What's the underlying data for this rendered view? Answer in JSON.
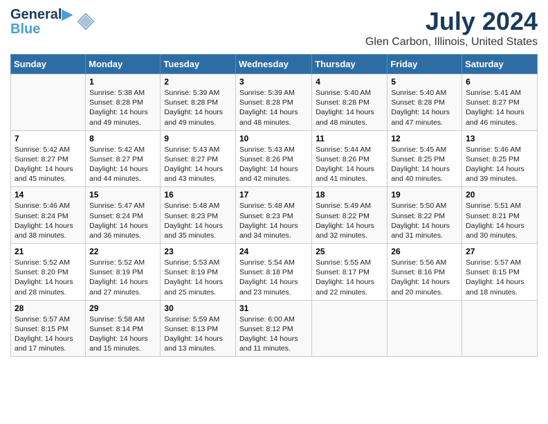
{
  "header": {
    "logo_line1": "General",
    "logo_line2": "Blue",
    "title": "July 2024",
    "subtitle": "Glen Carbon, Illinois, United States"
  },
  "days_of_week": [
    "Sunday",
    "Monday",
    "Tuesday",
    "Wednesday",
    "Thursday",
    "Friday",
    "Saturday"
  ],
  "weeks": [
    [
      {
        "day": "",
        "info": ""
      },
      {
        "day": "1",
        "info": "Sunrise: 5:38 AM\nSunset: 8:28 PM\nDaylight: 14 hours\nand 49 minutes."
      },
      {
        "day": "2",
        "info": "Sunrise: 5:39 AM\nSunset: 8:28 PM\nDaylight: 14 hours\nand 49 minutes."
      },
      {
        "day": "3",
        "info": "Sunrise: 5:39 AM\nSunset: 8:28 PM\nDaylight: 14 hours\nand 48 minutes."
      },
      {
        "day": "4",
        "info": "Sunrise: 5:40 AM\nSunset: 8:28 PM\nDaylight: 14 hours\nand 48 minutes."
      },
      {
        "day": "5",
        "info": "Sunrise: 5:40 AM\nSunset: 8:28 PM\nDaylight: 14 hours\nand 47 minutes."
      },
      {
        "day": "6",
        "info": "Sunrise: 5:41 AM\nSunset: 8:27 PM\nDaylight: 14 hours\nand 46 minutes."
      }
    ],
    [
      {
        "day": "7",
        "info": "Sunrise: 5:42 AM\nSunset: 8:27 PM\nDaylight: 14 hours\nand 45 minutes."
      },
      {
        "day": "8",
        "info": "Sunrise: 5:42 AM\nSunset: 8:27 PM\nDaylight: 14 hours\nand 44 minutes."
      },
      {
        "day": "9",
        "info": "Sunrise: 5:43 AM\nSunset: 8:27 PM\nDaylight: 14 hours\nand 43 minutes."
      },
      {
        "day": "10",
        "info": "Sunrise: 5:43 AM\nSunset: 8:26 PM\nDaylight: 14 hours\nand 42 minutes."
      },
      {
        "day": "11",
        "info": "Sunrise: 5:44 AM\nSunset: 8:26 PM\nDaylight: 14 hours\nand 41 minutes."
      },
      {
        "day": "12",
        "info": "Sunrise: 5:45 AM\nSunset: 8:25 PM\nDaylight: 14 hours\nand 40 minutes."
      },
      {
        "day": "13",
        "info": "Sunrise: 5:46 AM\nSunset: 8:25 PM\nDaylight: 14 hours\nand 39 minutes."
      }
    ],
    [
      {
        "day": "14",
        "info": "Sunrise: 5:46 AM\nSunset: 8:24 PM\nDaylight: 14 hours\nand 38 minutes."
      },
      {
        "day": "15",
        "info": "Sunrise: 5:47 AM\nSunset: 8:24 PM\nDaylight: 14 hours\nand 36 minutes."
      },
      {
        "day": "16",
        "info": "Sunrise: 5:48 AM\nSunset: 8:23 PM\nDaylight: 14 hours\nand 35 minutes."
      },
      {
        "day": "17",
        "info": "Sunrise: 5:48 AM\nSunset: 8:23 PM\nDaylight: 14 hours\nand 34 minutes."
      },
      {
        "day": "18",
        "info": "Sunrise: 5:49 AM\nSunset: 8:22 PM\nDaylight: 14 hours\nand 32 minutes."
      },
      {
        "day": "19",
        "info": "Sunrise: 5:50 AM\nSunset: 8:22 PM\nDaylight: 14 hours\nand 31 minutes."
      },
      {
        "day": "20",
        "info": "Sunrise: 5:51 AM\nSunset: 8:21 PM\nDaylight: 14 hours\nand 30 minutes."
      }
    ],
    [
      {
        "day": "21",
        "info": "Sunrise: 5:52 AM\nSunset: 8:20 PM\nDaylight: 14 hours\nand 28 minutes."
      },
      {
        "day": "22",
        "info": "Sunrise: 5:52 AM\nSunset: 8:19 PM\nDaylight: 14 hours\nand 27 minutes."
      },
      {
        "day": "23",
        "info": "Sunrise: 5:53 AM\nSunset: 8:19 PM\nDaylight: 14 hours\nand 25 minutes."
      },
      {
        "day": "24",
        "info": "Sunrise: 5:54 AM\nSunset: 8:18 PM\nDaylight: 14 hours\nand 23 minutes."
      },
      {
        "day": "25",
        "info": "Sunrise: 5:55 AM\nSunset: 8:17 PM\nDaylight: 14 hours\nand 22 minutes."
      },
      {
        "day": "26",
        "info": "Sunrise: 5:56 AM\nSunset: 8:16 PM\nDaylight: 14 hours\nand 20 minutes."
      },
      {
        "day": "27",
        "info": "Sunrise: 5:57 AM\nSunset: 8:15 PM\nDaylight: 14 hours\nand 18 minutes."
      }
    ],
    [
      {
        "day": "28",
        "info": "Sunrise: 5:57 AM\nSunset: 8:15 PM\nDaylight: 14 hours\nand 17 minutes."
      },
      {
        "day": "29",
        "info": "Sunrise: 5:58 AM\nSunset: 8:14 PM\nDaylight: 14 hours\nand 15 minutes."
      },
      {
        "day": "30",
        "info": "Sunrise: 5:59 AM\nSunset: 8:13 PM\nDaylight: 14 hours\nand 13 minutes."
      },
      {
        "day": "31",
        "info": "Sunrise: 6:00 AM\nSunset: 8:12 PM\nDaylight: 14 hours\nand 11 minutes."
      },
      {
        "day": "",
        "info": ""
      },
      {
        "day": "",
        "info": ""
      },
      {
        "day": "",
        "info": ""
      }
    ]
  ]
}
